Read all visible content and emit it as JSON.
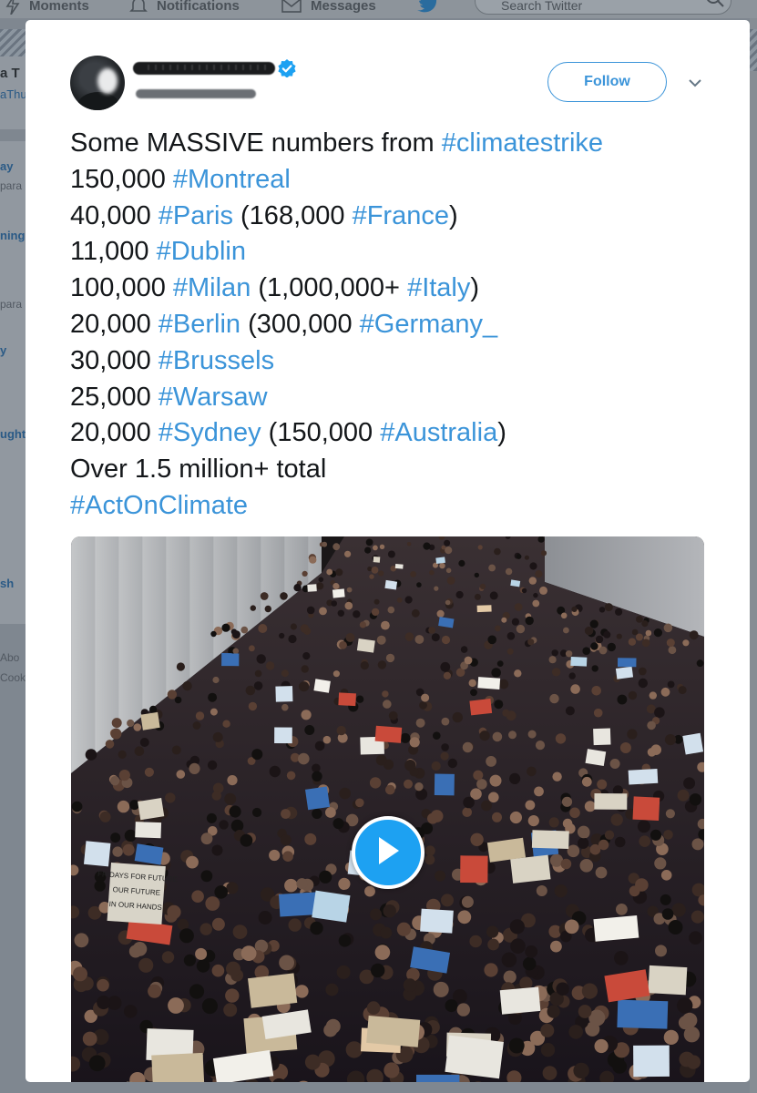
{
  "nav": {
    "moments": "Moments",
    "notifications": "Notifications",
    "messages": "Messages",
    "search_placeholder": "Search Twitter"
  },
  "left_column": {
    "t1": "a T",
    "t2": "aThu",
    "t3": "ay",
    "t4": "para",
    "t5": "ning",
    "t6": "para",
    "t7": "y",
    "t8": "ught",
    "t9": "sh",
    "t10": "Abo",
    "t11": "Cook"
  },
  "tweet": {
    "follow_label": "Follow",
    "lines": [
      [
        {
          "text": "Some MASSIVE numbers from "
        },
        {
          "text": "#climatestrike",
          "tag": true
        }
      ],
      [
        {
          "text": "150,000 "
        },
        {
          "text": "#Montreal",
          "tag": true
        }
      ],
      [
        {
          "text": "40,000 "
        },
        {
          "text": "#Paris",
          "tag": true
        },
        {
          "text": " (168,000 "
        },
        {
          "text": "#France",
          "tag": true
        },
        {
          "text": ")"
        }
      ],
      [
        {
          "text": "11,000 "
        },
        {
          "text": "#Dublin",
          "tag": true
        }
      ],
      [
        {
          "text": "100,000 "
        },
        {
          "text": "#Milan",
          "tag": true
        },
        {
          "text": " (1,000,000+ "
        },
        {
          "text": "#Italy",
          "tag": true
        },
        {
          "text": ")"
        }
      ],
      [
        {
          "text": "20,000 "
        },
        {
          "text": "#Berlin",
          "tag": true
        },
        {
          "text": " (300,000 "
        },
        {
          "text": "#Germany_",
          "tag": true
        }
      ],
      [
        {
          "text": "30,000 "
        },
        {
          "text": "#Brussels",
          "tag": true
        }
      ],
      [
        {
          "text": "25,000 "
        },
        {
          "text": "#Warsaw",
          "tag": true
        }
      ],
      [
        {
          "text": "20,000 "
        },
        {
          "text": "#Sydney",
          "tag": true
        },
        {
          "text": " (150,000 "
        },
        {
          "text": "#Australia",
          "tag": true
        },
        {
          "text": ")"
        }
      ],
      [
        {
          "text": "Over 1.5 million+ total"
        }
      ],
      [
        {
          "text": "#ActOnClimate",
          "tag": true
        }
      ]
    ],
    "video_signs": [
      "FRIDAYS FOR FUTURE",
      "OUR FUTURE",
      "IN OUR HANDS"
    ]
  },
  "colors": {
    "link_blue": "#3b94d9",
    "play_blue": "#1da1f2",
    "text": "#14171a"
  },
  "icons": [
    "lightning-icon",
    "bell-icon",
    "envelope-icon",
    "twitter-bird-icon",
    "search-icon",
    "verified-badge-icon",
    "chevron-down-icon",
    "play-icon"
  ]
}
